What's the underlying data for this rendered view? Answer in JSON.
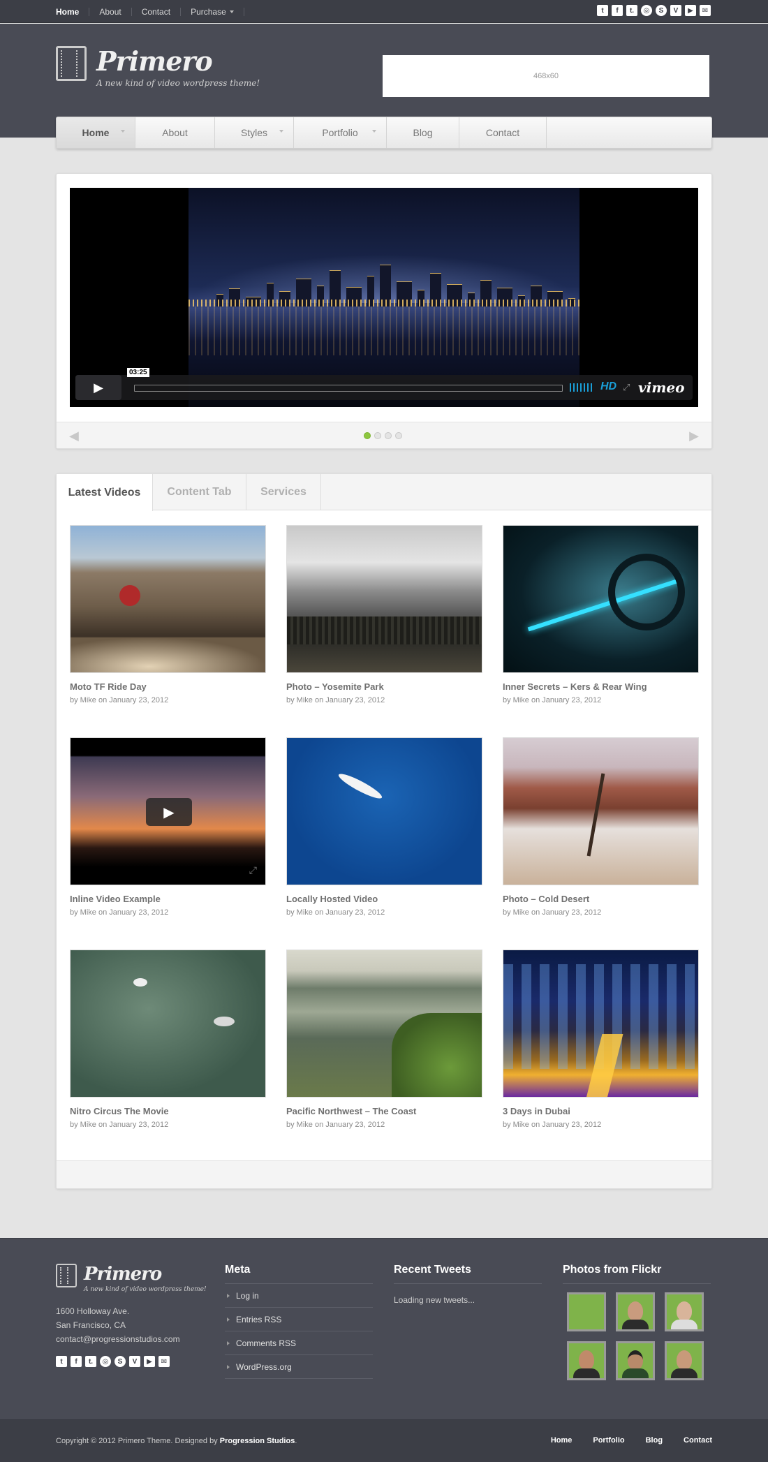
{
  "topbar": {
    "nav": [
      {
        "label": "Home",
        "active": true
      },
      {
        "label": "About"
      },
      {
        "label": "Contact"
      },
      {
        "label": "Purchase",
        "has_dropdown": true
      }
    ],
    "socials": [
      "twitter-icon",
      "facebook-icon",
      "tumblr-icon",
      "dribbble-icon",
      "skype-icon",
      "vimeo-icon",
      "youtube-icon",
      "email-icon"
    ]
  },
  "header": {
    "logo_name": "Primero",
    "tagline": "A new kind of video wordpress theme!",
    "ad_label": "468x60"
  },
  "mainnav": [
    {
      "label": "Home",
      "active": true,
      "has_dropdown": true
    },
    {
      "label": "About"
    },
    {
      "label": "Styles",
      "has_dropdown": true
    },
    {
      "label": "Portfolio",
      "has_dropdown": true
    },
    {
      "label": "Blog"
    },
    {
      "label": "Contact"
    }
  ],
  "slider": {
    "timecode": "03:25",
    "hd_label": "HD",
    "brand": "vimeo",
    "slide_count": 4,
    "active_slide": 1,
    "accent_color": "#1a9fd8"
  },
  "tabs": [
    {
      "label": "Latest Videos",
      "active": true
    },
    {
      "label": "Content Tab"
    },
    {
      "label": "Services"
    }
  ],
  "videos": [
    {
      "title": "Moto TF Ride Day",
      "meta": "by Mike on January 23, 2012"
    },
    {
      "title": "Photo – Yosemite Park",
      "meta": "by Mike on January 23, 2012"
    },
    {
      "title": "Inner Secrets – Kers & Rear Wing",
      "meta": "by Mike on January 23, 2012"
    },
    {
      "title": "Inline Video Example",
      "meta": "by Mike on January 23, 2012"
    },
    {
      "title": "Locally Hosted Video",
      "meta": "by Mike on January 23, 2012"
    },
    {
      "title": "Photo – Cold Desert",
      "meta": "by Mike on January 23, 2012"
    },
    {
      "title": "Nitro Circus The Movie",
      "meta": "by Mike on January 23, 2012"
    },
    {
      "title": "Pacific Northwest – The Coast",
      "meta": "by Mike on January 23, 2012"
    },
    {
      "title": "3 Days in Dubai",
      "meta": "by Mike on January 23, 2012"
    }
  ],
  "footer": {
    "logo_name": "Primero",
    "tagline": "A new kind of video wordpress theme!",
    "address": [
      "1600 Holloway Ave.",
      "San Francisco, CA",
      "contact@progressionstudios.com"
    ],
    "meta_title": "Meta",
    "meta_links": [
      "Log in",
      "Entries RSS",
      "Comments RSS",
      "WordPress.org"
    ],
    "tweets_title": "Recent Tweets",
    "tweets_text": "Loading new tweets...",
    "flickr_title": "Photos from Flickr"
  },
  "bottombar": {
    "copyright": "Copyright © 2012 Primero Theme. Designed by ",
    "designer": "Progression Studios",
    "copyright_end": ".",
    "nav": [
      "Home",
      "Portfolio",
      "Blog",
      "Contact"
    ]
  }
}
